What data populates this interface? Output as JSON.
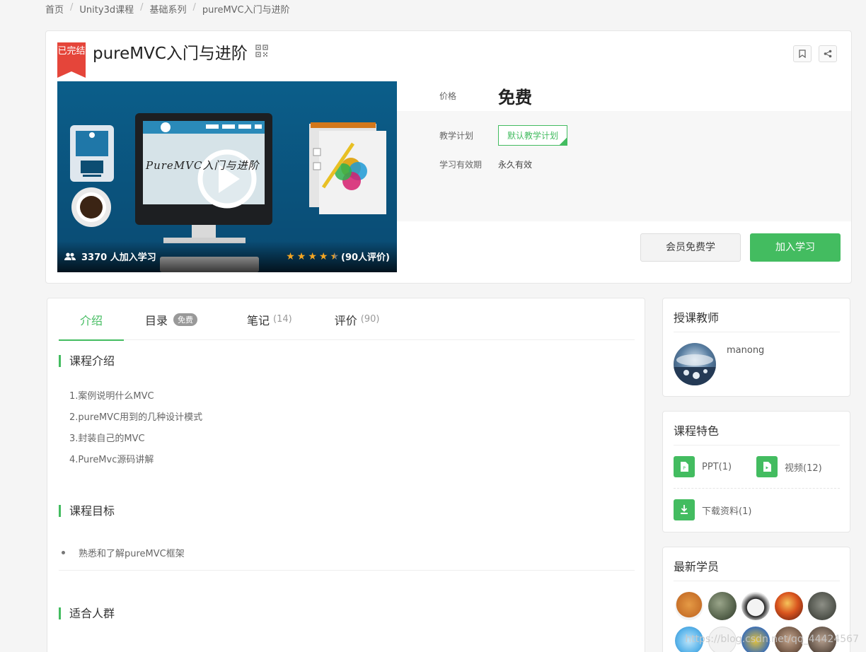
{
  "breadcrumb": [
    "首页",
    "Unity3d课程",
    "基础系列",
    "pureMVC入门与进阶"
  ],
  "course": {
    "status_badge": "已完结",
    "title": "pureMVC入门与进阶",
    "cover_text": "PureMVC入门与进阶",
    "students_text": "3370 人加入学习",
    "rating_stars": 4.5,
    "rating_text": "(90人评价)"
  },
  "pricing": {
    "price_label": "价格",
    "price_value": "免费",
    "plan_label": "教学计划",
    "plan_value": "默认教学计划",
    "validity_label": "学习有效期",
    "validity_value": "永久有效"
  },
  "actions": {
    "member_label": "会员免费学",
    "join_label": "加入学习"
  },
  "tabs": [
    {
      "label": "介绍",
      "count": ""
    },
    {
      "label": "目录",
      "badge": "免费"
    },
    {
      "label": "笔记",
      "count": "(14)"
    },
    {
      "label": "评价",
      "count": "(90)"
    }
  ],
  "intro": {
    "title": "课程介绍",
    "lines": [
      "1.案例说明什么MVC",
      "2.pureMVC用到的几种设计模式",
      "3.封装自己的MVC",
      "4.PureMvc源码讲解"
    ]
  },
  "goals": {
    "title": "课程目标",
    "items": [
      "熟悉和了解pureMVC框架"
    ]
  },
  "audience": {
    "title": "适合人群"
  },
  "teacher": {
    "title": "授课教师",
    "name": "manong"
  },
  "features": {
    "title": "课程特色",
    "items": [
      {
        "label": "PPT(1)",
        "icon": "ppt-file-icon"
      },
      {
        "label": "视频(12)",
        "icon": "video-file-icon"
      },
      {
        "label": "下载资料(1)",
        "icon": "download-icon"
      }
    ]
  },
  "latest_students": {
    "title": "最新学员"
  },
  "watermark": "https://blog.csdn.net/qq_44424567",
  "colors": {
    "accent": "#43bc60",
    "badge_red": "#e5453a",
    "star": "#f5a623"
  }
}
